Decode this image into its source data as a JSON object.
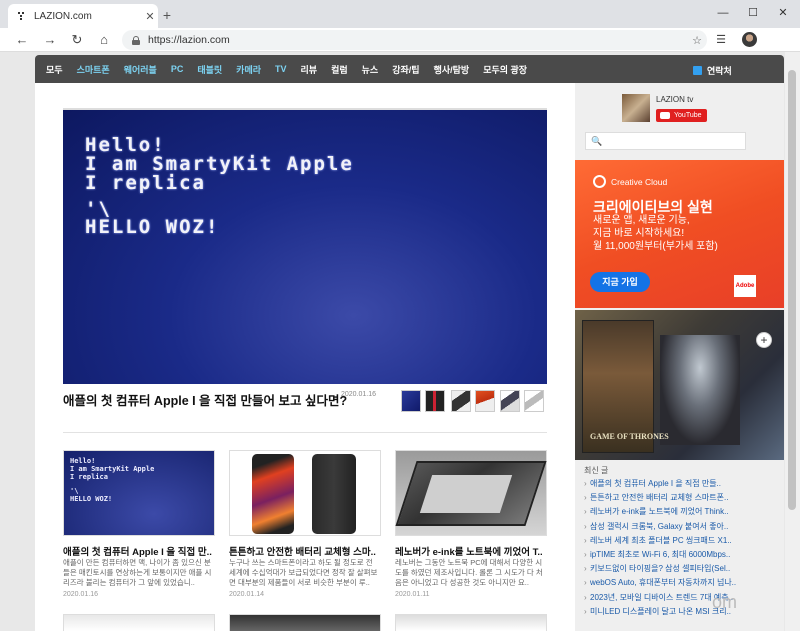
{
  "browser": {
    "tab_title": "LAZION.com",
    "tab_close": "✕",
    "new_tab": "+",
    "url": "https://lazion.com",
    "win_min": "—",
    "win_max": "☐",
    "win_close": "✕",
    "icons": [
      "back-icon",
      "forward-icon",
      "refresh-icon",
      "home-icon",
      "lock-icon",
      "star-icon",
      "favorites-icon"
    ]
  },
  "nav": {
    "items": [
      "모두",
      "스마트폰",
      "웨어러블",
      "PC",
      "태블릿",
      "카메라",
      "TV",
      "리뷰",
      "컬럼",
      "뉴스",
      "강좌/팁",
      "행사/탐방",
      "모두의 광장"
    ],
    "highlighted": [
      1,
      2,
      3,
      4,
      5,
      6
    ],
    "contact": "연락처"
  },
  "hero": {
    "screen_line1": "Hello!",
    "screen_line2": "I am SmartyKit Apple",
    "screen_line3": "I replica",
    "screen_line4": "'\\",
    "screen_line5": "HELLO WOZ!",
    "title": "애플의 첫 컴퓨터 Apple I 을 직접 만들어 보고 싶다면?",
    "date": "2020.01.16"
  },
  "cards": [
    {
      "title": "애플의 첫 컴퓨터 Apple I 을 직접 만..",
      "text": "애플이 만든 컴퓨터하면 맥, 나이가 좀 있으신 분들은 매킨토시를 연상하는게 보통이지만 애플 시리즈라 불리는 컴퓨터가 그 앞에 있었습니..",
      "date": "2020.01.16"
    },
    {
      "title": "튼튼하고 안전한 배터리 교체형 스마..",
      "text": "누구나 쓰는 스마트폰이라고 하도 될 정도로 전세계에 수십억대가 보급되었다면 정작 잘 살펴보면 대부분의 제품들이 서로 비슷한 부분이 루..",
      "date": "2020.01.14"
    },
    {
      "title": "레노버가 e-ink를 노트북에 끼었어 T..",
      "text": "레노버는 그동안 노트북 PC에 대해서 다양한 시도를 하였던 제조사입니다. 롤론 그 시도가 다 처음은 아니었고 다 성공한 것도 아니지만 요..",
      "date": "2020.01.11"
    }
  ],
  "sidebar": {
    "channel_name": "LAZION tv",
    "youtube_label": "YouTube",
    "search_placeholder": "🔍",
    "ad1": {
      "brand": "Creative Cloud",
      "headline": "크리에이티브의 실현",
      "line1": "새로운 앱, 새로운 기능,",
      "line2": "지금 바로 시작하세요!",
      "line3": "월 11,000원부터(부가세 포함)",
      "button": "지금 가입",
      "logo": "Adobe"
    },
    "ad2": {
      "logo": "GAME OF THRONES"
    },
    "plus": "+",
    "recent_heading": "최신 글",
    "recent": [
      "애플의 첫 컴퓨터 Apple I 을 직접 만들..",
      "튼튼하고 안전한 배터리 교체형 스마트폰..",
      "레노버가 e-ink를 노트북에 끼었어 Think..",
      "삼성 갤럭시 크롬북, Galaxy 붙여서 좋아..",
      "레노버 세계 최초 폴더블 PC 씽크패드 X1..",
      "ipTIME 최초로 Wi-Fi 6, 최대 6000Mbps..",
      "키보드없이 타이핑을? 삼성 셀피타입(Sel..",
      "webOS Auto, 휴대폰부터 자동차까지 넘나..",
      "2023년, 모바일 디바이스 트렌드 7대 예측..",
      "미니LED 디스플레이 달고 나온 MSI 크리.."
    ],
    "watermark": "om"
  }
}
